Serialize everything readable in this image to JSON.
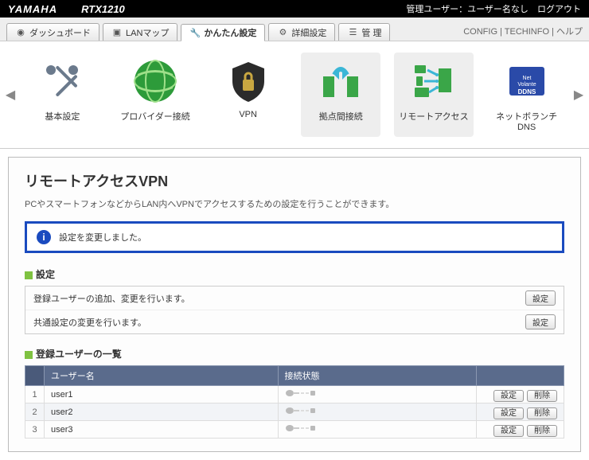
{
  "header": {
    "brand": "YAMAHA",
    "model": "RTX1210",
    "user_label": "管理ユーザー：ユーザー名なし",
    "logout": "ログアウト"
  },
  "tabs": {
    "dashboard": "ダッシュボード",
    "lanmap": "LANマップ",
    "easy": "かんたん設定",
    "detail": "詳細設定",
    "admin": "管 理",
    "config": "CONFIG",
    "techinfo": "TECHINFO",
    "help": "ヘルプ"
  },
  "carousel": {
    "items": [
      {
        "label": "基本設定"
      },
      {
        "label": "プロバイダー接続"
      },
      {
        "label": "VPN"
      },
      {
        "label": "拠点間接続"
      },
      {
        "label": "リモートアクセス"
      },
      {
        "label": "ネットボランチDNS"
      }
    ]
  },
  "page": {
    "title": "リモートアクセスVPN",
    "desc": "PCやスマートフォンなどからLAN内へVPNでアクセスするための設定を行うことができます。",
    "notice": "設定を変更しました。"
  },
  "sections": {
    "settings_title": "設定",
    "row1": "登録ユーザーの追加、変更を行います。",
    "row2": "共通設定の変更を行います。",
    "users_title": "登録ユーザーの一覧",
    "col_user": "ユーザー名",
    "col_status": "接続状態",
    "btn_set": "設定",
    "btn_del": "削除"
  },
  "users": [
    {
      "n": "1",
      "name": "user1"
    },
    {
      "n": "2",
      "name": "user2"
    },
    {
      "n": "3",
      "name": "user3"
    }
  ]
}
